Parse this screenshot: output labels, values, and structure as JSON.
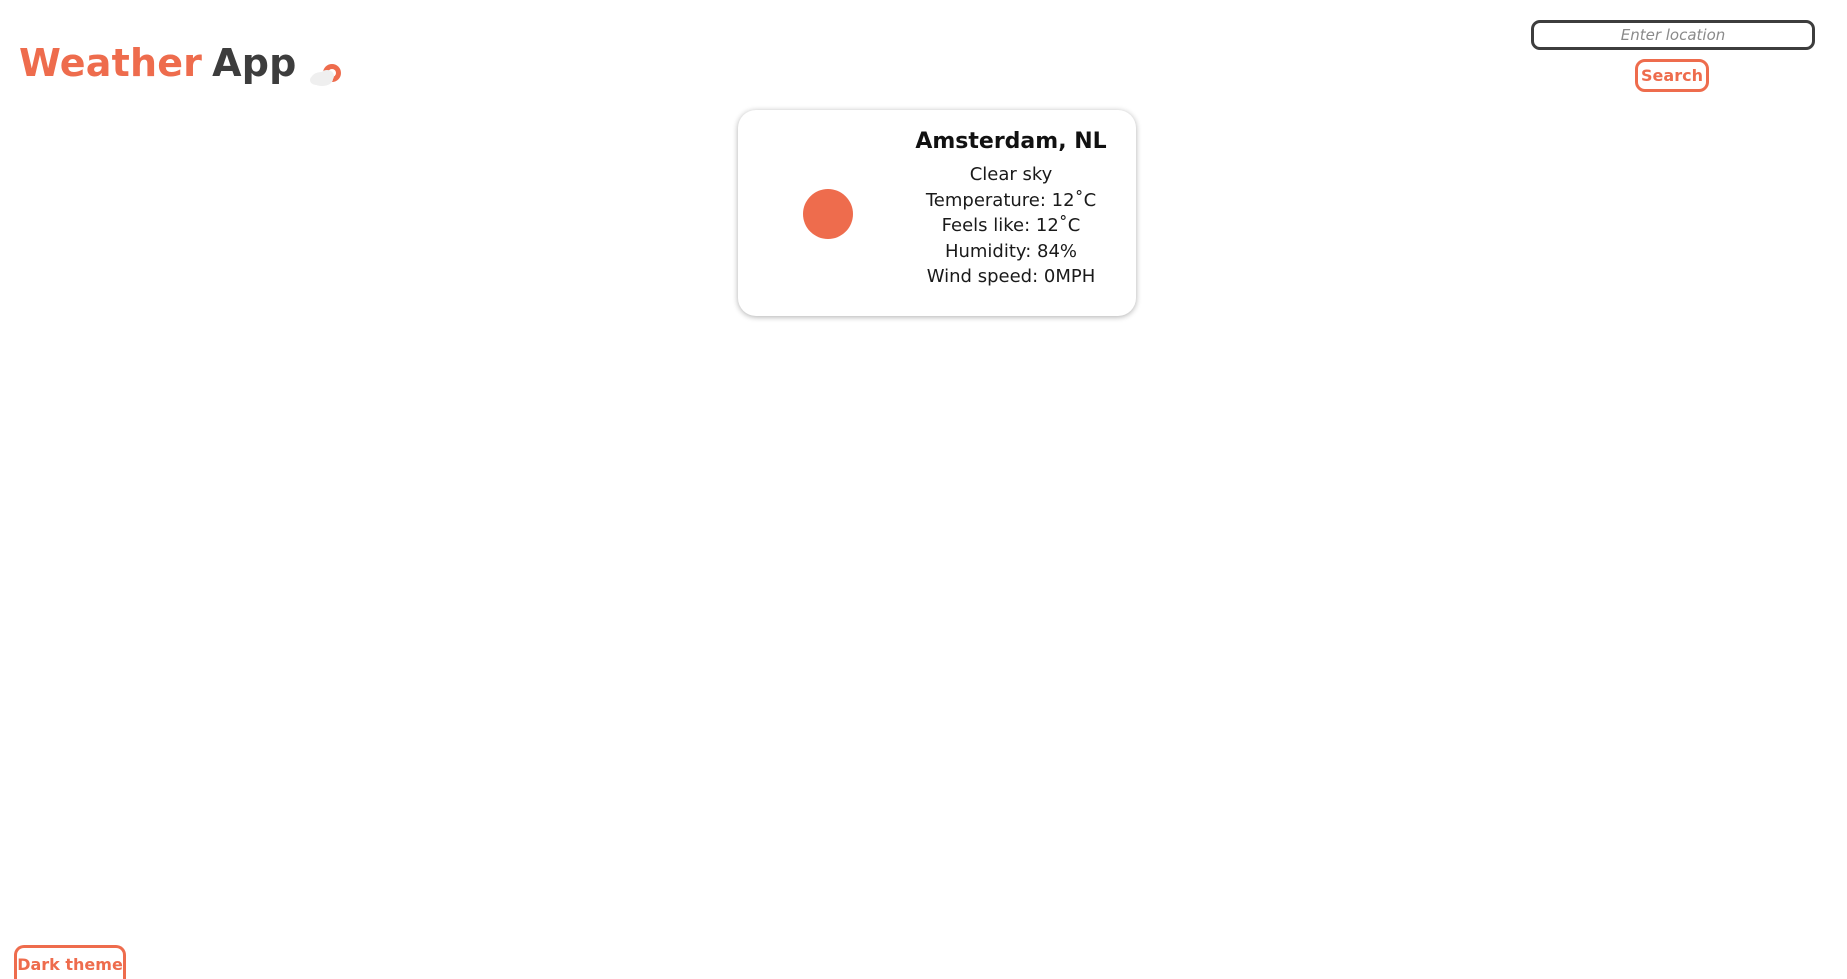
{
  "header": {
    "title_part1": "Weather",
    "title_part2": "App",
    "title_icon": "partly-cloudy-icon"
  },
  "search": {
    "placeholder": "Enter location",
    "value": "",
    "button_label": "Search"
  },
  "weather": {
    "location": "Amsterdam, NL",
    "condition_icon": "sun-icon",
    "description": "Clear sky",
    "temperature": "Temperature: 12˚C",
    "feels_like": "Feels like: 12˚C",
    "humidity": "Humidity: 84%",
    "wind_speed": "Wind speed: 0MPH"
  },
  "footer": {
    "theme_button_label": "Dark theme"
  },
  "colors": {
    "accent": "#ee6c4d",
    "dark": "#3d3d3d",
    "background": "#ffffff",
    "cloud": "#eeeeee"
  }
}
